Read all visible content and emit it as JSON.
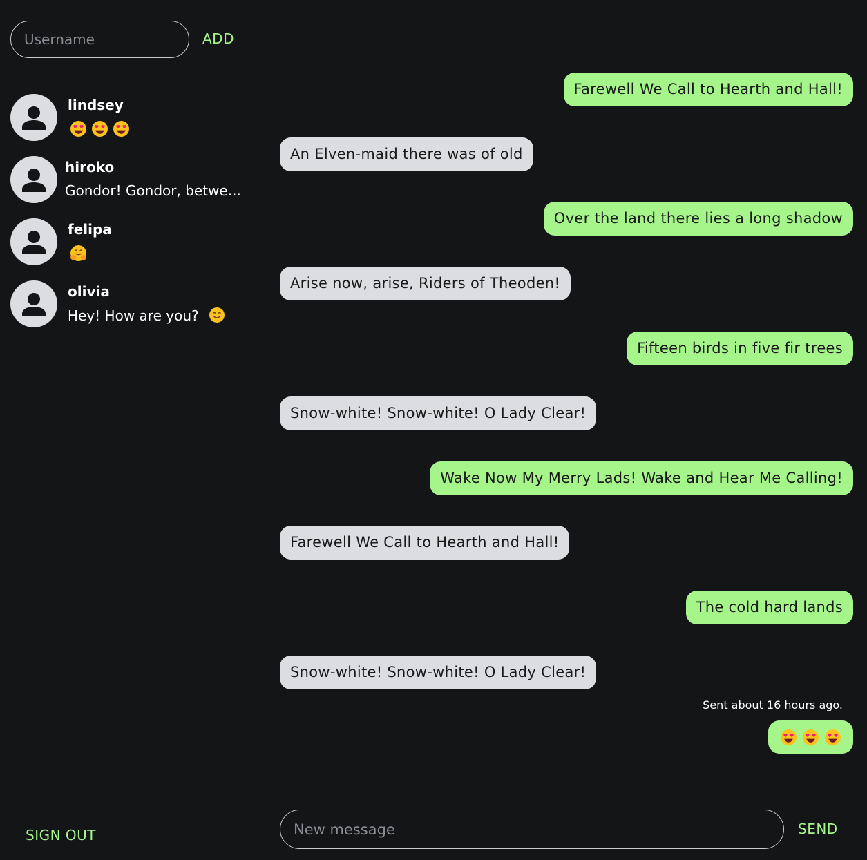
{
  "sidebar": {
    "username_placeholder": "Username",
    "add_label": "ADD",
    "signout_label": "SIGN OUT",
    "contacts": [
      {
        "name": "lindsey",
        "preview_emojis": [
          "heart-eyes-emoji",
          "heart-eyes-emoji",
          "heart-eyes-emoji"
        ]
      },
      {
        "name": "hiroko",
        "preview": "Gondor! Gondor, betwe..."
      },
      {
        "name": "felipa",
        "preview_emojis": [
          "hugging-face-emoji"
        ]
      },
      {
        "name": "olivia",
        "preview": "Hey! How are you?",
        "preview_emoji": "smiling-face-emoji"
      }
    ]
  },
  "chat": {
    "messages": [
      {
        "side": "sent",
        "text": "Farewell We Call to Hearth and Hall!"
      },
      {
        "side": "received",
        "text": "An Elven-maid there was of old"
      },
      {
        "side": "sent",
        "text": "Over the land there lies a long shadow"
      },
      {
        "side": "received",
        "text": "Arise now, arise, Riders of Theoden!"
      },
      {
        "side": "sent",
        "text": "Fifteen birds in five fir trees"
      },
      {
        "side": "received",
        "text": "Snow-white! Snow-white! O Lady Clear!"
      },
      {
        "side": "sent",
        "text": "Wake Now My Merry Lads! Wake and Hear Me Calling!"
      },
      {
        "side": "received",
        "text": "Farewell We Call to Hearth and Hall!"
      },
      {
        "side": "sent",
        "text": "The cold hard lands"
      },
      {
        "side": "received",
        "text": "Snow-white! Snow-white! O Lady Clear!"
      },
      {
        "side": "sent",
        "emojis": [
          "heart-eyes-emoji",
          "heart-eyes-emoji",
          "heart-eyes-emoji"
        ]
      }
    ],
    "sent_time": "Sent about 16 hours ago.",
    "message_placeholder": "New message",
    "send_label": "SEND"
  },
  "colors": {
    "background": "#141517",
    "accent": "#a6f58b",
    "received_bubble": "#dcdde1",
    "divider": "#3b3d42"
  }
}
